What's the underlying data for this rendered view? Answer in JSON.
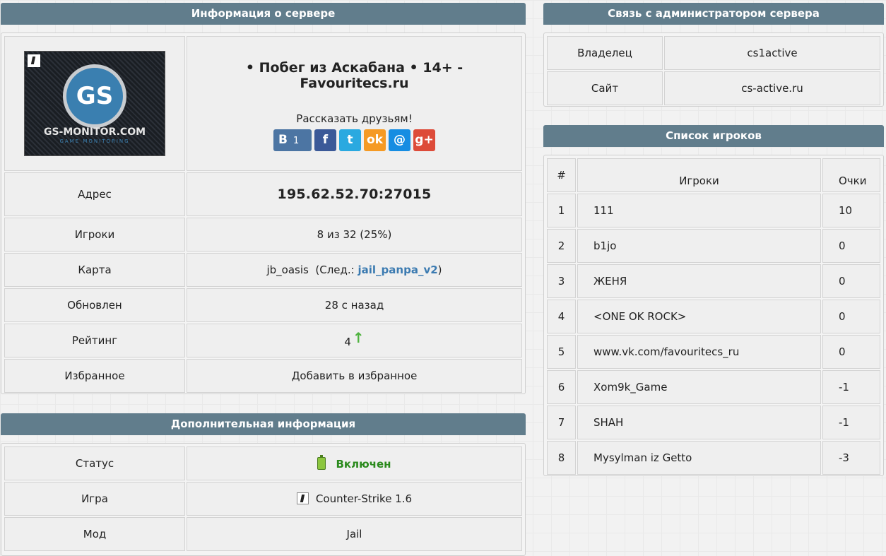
{
  "server_info": {
    "title": "Информация о сервере",
    "logo": {
      "brand": "GS-MONITOR.COM",
      "sub": "GAME MONITORING",
      "badge": "GS"
    },
    "server_name": "• Побег из Аскабана • 14+ - Favouritecs.ru",
    "share_label": "Рассказать друзьям!",
    "share": {
      "vk_letter": "B",
      "vk_count": "1",
      "fb": "f",
      "tw": "t",
      "ok": "ok",
      "mr": "@",
      "gp": "g+"
    },
    "rows": {
      "address_label": "Адрес",
      "address_value": "195.62.52.70:27015",
      "players_label": "Игроки",
      "players_value": "8 из 32 (25%)",
      "map_label": "Карта",
      "map_value": "jb_oasis",
      "map_next_prefix": "(След.:",
      "map_next": "jail_panpa_v2",
      "map_next_suffix": ")",
      "updated_label": "Обновлен",
      "updated_value": "28 с назад",
      "rating_label": "Рейтинг",
      "rating_value": "4",
      "rating_arrow": "↑",
      "favorites_label": "Избранное",
      "favorites_value": "Добавить в избранное"
    }
  },
  "extra_info": {
    "title": "Дополнительная информация",
    "status_label": "Статус",
    "status_value": "Включен",
    "game_label": "Игра",
    "game_value": "Counter-Strike 1.6",
    "mod_label": "Мод",
    "mod_value": "Jail"
  },
  "admin": {
    "title": "Связь с администратором сервера",
    "owner_label": "Владелец",
    "owner_value": "cs1active",
    "site_label": "Сайт",
    "site_value": "cs-active.ru"
  },
  "players": {
    "title": "Список игроков",
    "headers": {
      "num": "#",
      "name": "Игроки",
      "score": "Очки"
    },
    "rows": [
      {
        "num": "1",
        "name": "111",
        "score": "10"
      },
      {
        "num": "2",
        "name": "b1jo",
        "score": "0"
      },
      {
        "num": "3",
        "name": "ЖЕНЯ",
        "score": "0"
      },
      {
        "num": "4",
        "name": "<ONE OK ROCK>",
        "score": "0"
      },
      {
        "num": "5",
        "name": "www.vk.com/favouritecs_ru",
        "score": "0"
      },
      {
        "num": "6",
        "name": "Xom9k_Game",
        "score": "-1"
      },
      {
        "num": "7",
        "name": "SHAH",
        "score": "-1"
      },
      {
        "num": "8",
        "name": "Mysylman iz Getto",
        "score": "-3"
      }
    ]
  },
  "colors": {
    "header_bg": "#617d8c",
    "link": "#3c7bb1",
    "online": "#2a8a1c",
    "rating_up": "#4fb33f"
  }
}
